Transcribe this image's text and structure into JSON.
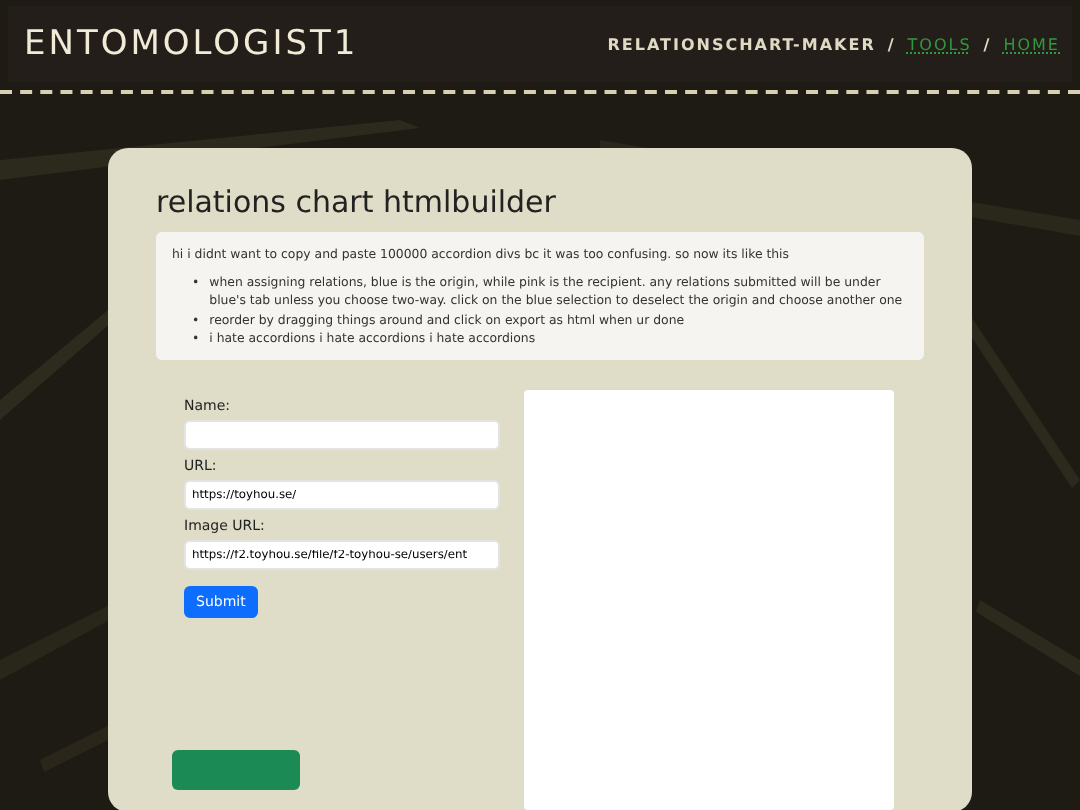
{
  "header": {
    "brand": "ENTOMOLOGIST1",
    "nav": [
      {
        "label": "RELATIONSCHART-MAKER",
        "kind": "current"
      },
      {
        "label": "/",
        "kind": "separator"
      },
      {
        "label": "TOOLS",
        "kind": "link"
      },
      {
        "label": "/",
        "kind": "separator"
      },
      {
        "label": "HOME",
        "kind": "link"
      }
    ]
  },
  "title": "relations chart htmlbuilder",
  "intro": "hi i didnt want to copy and paste 100000 accordion divs bc it was too confusing. so now its like this",
  "bullet": "•",
  "notes": [
    "when assigning relations, blue is the origin, while pink is the recipient. any relations submitted will be under blue's tab unless you choose two-way. click on the blue selection to deselect the origin and choose another one",
    "reorder by dragging things around and click on export as html when ur done",
    "i hate accordions i hate accordions i hate accordions"
  ],
  "form": {
    "fields": [
      {
        "label": "Name:"
      },
      {
        "label": "URL:",
        "value": "https://toyhou.se/"
      },
      {
        "label": "Image URL:",
        "value": "https://f2.toyhou.se/file/f2-toyhou-se/users/ent"
      }
    ],
    "submit": "Submit"
  }
}
